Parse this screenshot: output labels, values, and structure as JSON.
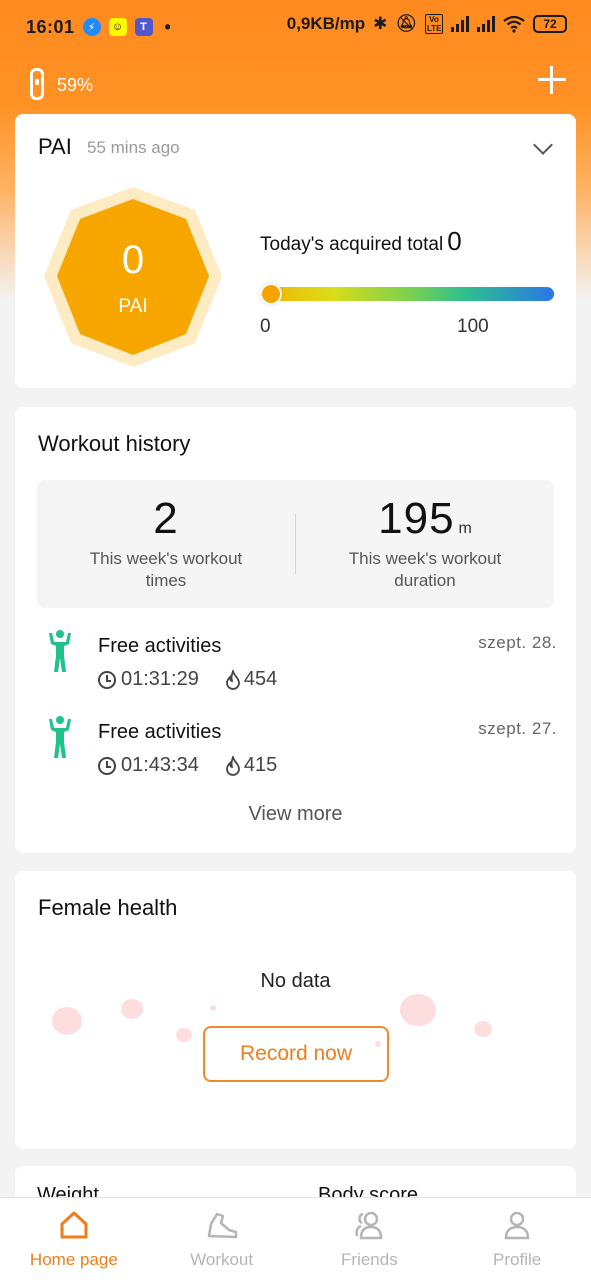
{
  "status_bar": {
    "time": "16:01",
    "network_speed": "0,9KB/mp",
    "battery": "72",
    "volte_badge": "Vo LTE"
  },
  "header": {
    "band_battery": "59%"
  },
  "pai": {
    "title": "PAI",
    "updated": "55 mins ago",
    "value": "0",
    "unit_label": "PAI",
    "today_label": "Today's acquired total",
    "today_value": "0",
    "scale_min": "0",
    "scale_max": "100",
    "progress_fraction": 0
  },
  "workout_history": {
    "title": "Workout history",
    "week_times_value": "2",
    "week_times_label": "This week's workout times",
    "week_duration_value": "195",
    "week_duration_unit": "m",
    "week_duration_label": "This week's workout duration",
    "activities": [
      {
        "name": "Free activities",
        "date": "szept. 28.",
        "duration": "01:31:29",
        "calories": "454"
      },
      {
        "name": "Free activities",
        "date": "szept. 27.",
        "duration": "01:43:34",
        "calories": "415"
      }
    ],
    "view_more": "View more"
  },
  "female_health": {
    "title": "Female health",
    "empty_text": "No data",
    "record_label": "Record now"
  },
  "peek": {
    "left_label": "Weight",
    "right_label": "Body score"
  },
  "bottom_nav": {
    "items": [
      {
        "label": "Home page",
        "icon": "home-icon",
        "active": true
      },
      {
        "label": "Workout",
        "icon": "shoe-icon",
        "active": false
      },
      {
        "label": "Friends",
        "icon": "friends-icon",
        "active": false
      },
      {
        "label": "Profile",
        "icon": "profile-icon",
        "active": false
      }
    ]
  },
  "colors": {
    "accent": "#ef7d1a",
    "header_orange": "#ff8a1f",
    "pai_hex": "#f7a600",
    "activity_green": "#1fc28a"
  }
}
